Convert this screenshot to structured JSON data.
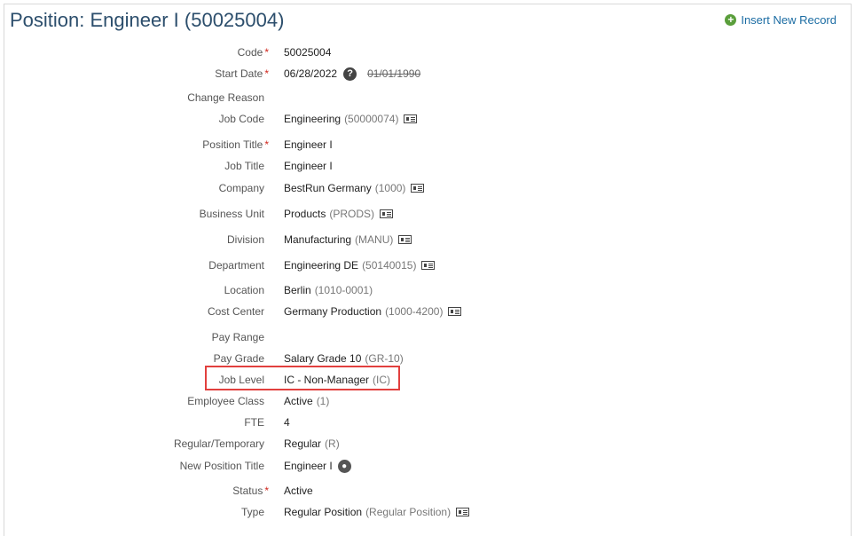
{
  "page": {
    "title": "Position: Engineer I (50025004)",
    "insert_label": "Insert New Record"
  },
  "fields": [
    {
      "label": "Code",
      "required": true,
      "value": "50025004",
      "code": ""
    },
    {
      "label": "Start Date",
      "required": true,
      "value": "06/28/2022",
      "code": "",
      "old_value": "01/01/1990",
      "help": "?"
    },
    {
      "label": "Change Reason",
      "required": false,
      "value": "",
      "code": ""
    },
    {
      "label": "Job Code",
      "required": false,
      "value": "Engineering",
      "code": "(50000074)",
      "card": true
    },
    {
      "label": "Position Title",
      "required": true,
      "value": "Engineer I",
      "code": ""
    },
    {
      "label": "Job Title",
      "required": false,
      "value": "Engineer I",
      "code": ""
    },
    {
      "label": "Company",
      "required": false,
      "value": "BestRun Germany",
      "code": "(1000)",
      "card": true
    },
    {
      "label": "Business Unit",
      "required": false,
      "value": "Products",
      "code": "(PRODS)",
      "card": true
    },
    {
      "label": "Division",
      "required": false,
      "value": "Manufacturing",
      "code": "(MANU)",
      "card": true
    },
    {
      "label": "Department",
      "required": false,
      "value": "Engineering DE",
      "code": "(50140015)",
      "card": true
    },
    {
      "label": "Location",
      "required": false,
      "value": "Berlin",
      "code": "(1010-0001)"
    },
    {
      "label": "Cost Center",
      "required": false,
      "value": "Germany Production",
      "code": "(1000-4200)",
      "card": true
    },
    {
      "label": "Pay Range",
      "required": false,
      "value": "",
      "code": ""
    },
    {
      "label": "Pay Grade",
      "required": false,
      "value": "Salary Grade 10",
      "code": "(GR-10)"
    },
    {
      "label": "Job Level",
      "required": false,
      "value": "IC - Non-Manager",
      "code": "(IC)"
    },
    {
      "label": "Employee Class",
      "required": false,
      "value": "Active",
      "code": "(1)"
    },
    {
      "label": "FTE",
      "required": false,
      "value": "4",
      "code": ""
    },
    {
      "label": "Regular/Temporary",
      "required": false,
      "value": "Regular",
      "code": "(R)"
    },
    {
      "label": "New Position Title",
      "required": false,
      "value": "Engineer I",
      "code": "",
      "globe": true
    },
    {
      "label": "Status",
      "required": true,
      "value": "Active",
      "code": ""
    },
    {
      "label": "Type",
      "required": false,
      "value": "Regular Position",
      "code": "(Regular Position)",
      "card": true
    }
  ],
  "colors": {
    "title": "#2c4e6c",
    "link": "#1b6ca3",
    "required": "#d0271d",
    "highlight": "#e2403e"
  }
}
